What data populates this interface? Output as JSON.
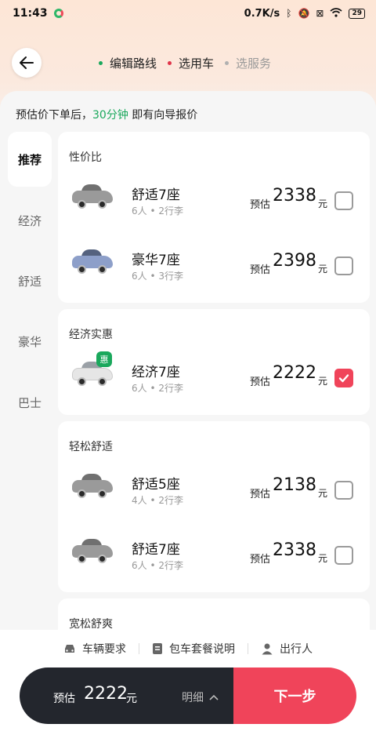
{
  "status_bar": {
    "time": "11:43",
    "net_speed": "0.7K/s",
    "battery": "29"
  },
  "header": {
    "steps": [
      {
        "label": "编辑路线",
        "dot_color": "#1aa85c"
      },
      {
        "label": "选用车",
        "dot_color": "#e0344a"
      },
      {
        "label": "选服务",
        "dot_color": "#b0b0b0"
      }
    ]
  },
  "notice": {
    "prefix": "预估价下单后，",
    "highlight": "30分钟",
    "suffix": " 即有向导报价"
  },
  "categories": [
    {
      "label": "推荐",
      "active": true
    },
    {
      "label": "经济",
      "active": false
    },
    {
      "label": "舒适",
      "active": false
    },
    {
      "label": "豪华",
      "active": false
    },
    {
      "label": "巴士",
      "active": false
    }
  ],
  "groups": [
    {
      "title": "性价比",
      "options": [
        {
          "name": "舒适7座",
          "spec": "6人 • 2行李",
          "est_label": "预估",
          "price": "2338",
          "unit": "元",
          "checked": false
        },
        {
          "name": "豪华7座",
          "spec": "6人 • 3行李",
          "est_label": "预估",
          "price": "2398",
          "unit": "元",
          "checked": false
        }
      ]
    },
    {
      "title": "经济实惠",
      "options": [
        {
          "name": "经济7座",
          "spec": "6人 • 2行李",
          "est_label": "预估",
          "price": "2222",
          "unit": "元",
          "checked": true,
          "badge": "惠"
        }
      ]
    },
    {
      "title": "轻松舒适",
      "options": [
        {
          "name": "舒适5座",
          "spec": "4人 • 2行李",
          "est_label": "预估",
          "price": "2138",
          "unit": "元",
          "checked": false
        },
        {
          "name": "舒适7座",
          "spec": "6人 • 2行李",
          "est_label": "预估",
          "price": "2338",
          "unit": "元",
          "checked": false
        }
      ]
    },
    {
      "title": "宽松舒爽",
      "options": []
    }
  ],
  "bottom": {
    "links": [
      {
        "label": "车辆要求",
        "icon": "car-icon"
      },
      {
        "label": "包车套餐说明",
        "icon": "document-icon"
      },
      {
        "label": "出行人",
        "icon": "person-icon"
      }
    ],
    "est_label": "预估",
    "price": "2222",
    "unit": "元",
    "detail_label": "明细",
    "next_label": "下一步"
  },
  "colors": {
    "accent_red": "#f0445a",
    "accent_green": "#1aa85c",
    "dark_bar": "#23262d"
  }
}
